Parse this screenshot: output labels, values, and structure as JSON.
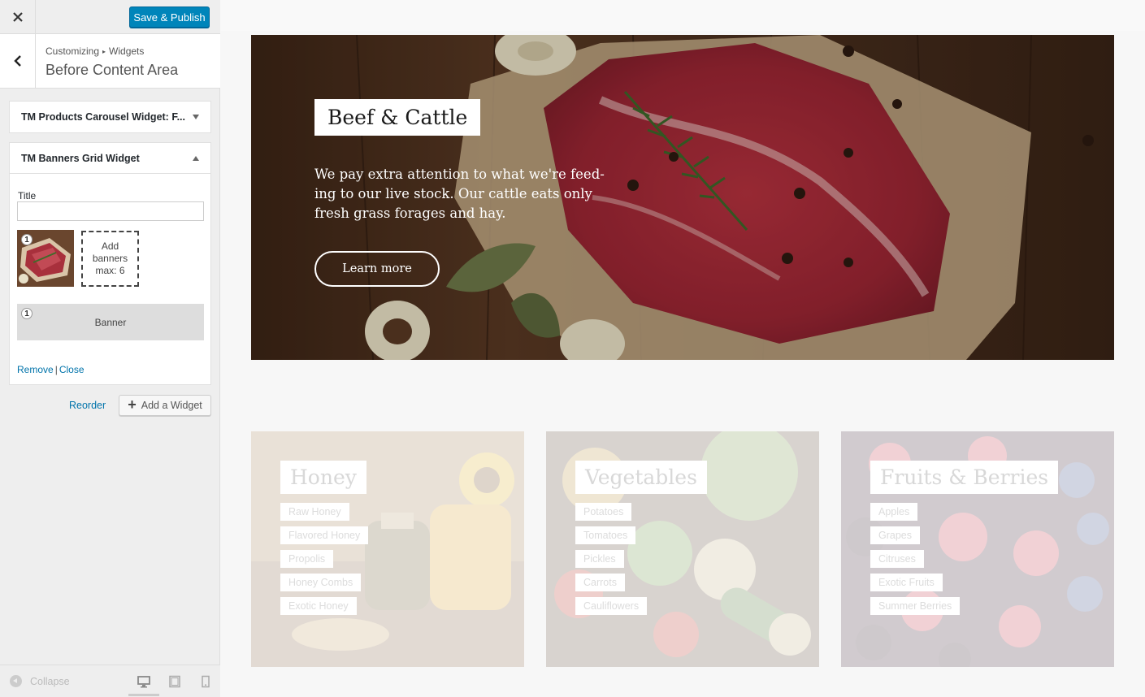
{
  "header": {
    "close_icon": "close-icon",
    "publish_label": "Save & Publish"
  },
  "section": {
    "breadcrumb_root": "Customizing",
    "breadcrumb_child": "Widgets",
    "title": "Before Content Area"
  },
  "widgets": {
    "collapsed_title": "TM Products Carousel Widget: F...",
    "expanded_title": "TM Banners Grid Widget",
    "title_label": "Title",
    "title_value": "",
    "thumb_number": "1",
    "add_banners_line1": "Add",
    "add_banners_line2": "banners",
    "add_banners_line3": "max: 6",
    "banner_number": "1",
    "banner_label": "Banner",
    "remove_label": "Remove",
    "separator": "|",
    "close_label": "Close"
  },
  "actions": {
    "reorder_label": "Reorder",
    "add_widget_label": "Add a Widget"
  },
  "footer": {
    "collapse_label": "Collapse",
    "devices": [
      "desktop-icon",
      "tablet-icon",
      "mobile-icon"
    ]
  },
  "hero": {
    "title": "Beef & Cattle",
    "text": "We pay extra attention to what we're feed-ing to our live stock. Our cattle eats only fresh grass forages and hay.",
    "button_label": "Learn more"
  },
  "cards": [
    {
      "title": "Honey",
      "items": [
        "Raw Honey",
        "Flavored Honey",
        "Propolis",
        "Honey Combs",
        "Exotic Honey"
      ]
    },
    {
      "title": "Vegetables",
      "items": [
        "Potatoes",
        "Tomatoes",
        "Pickles",
        "Carrots",
        "Cauliflowers"
      ]
    },
    {
      "title": "Fruits & Berries",
      "items": [
        "Apples",
        "Grapes",
        "Citruses",
        "Exotic Fruits",
        "Summer Berries"
      ]
    }
  ],
  "colors": {
    "accent": "#0085ba",
    "link": "#0073aa"
  }
}
